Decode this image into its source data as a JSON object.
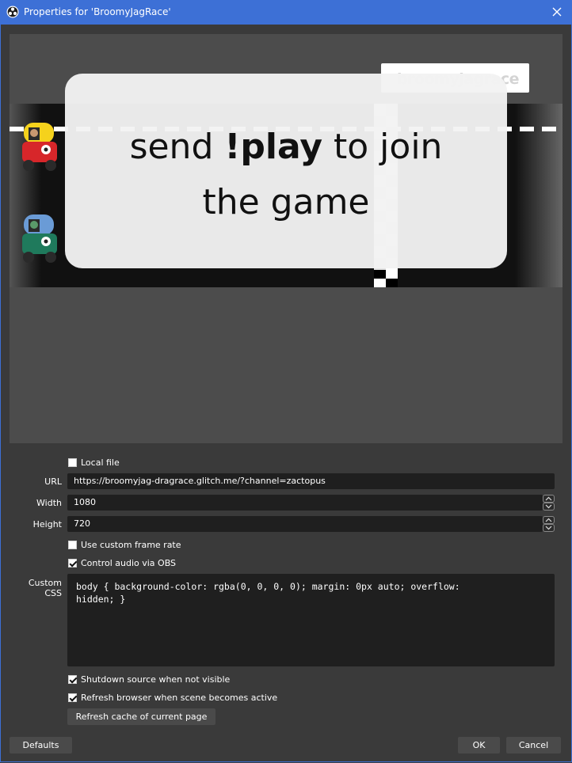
{
  "window": {
    "title": "Properties for 'BroomyJagRace'",
    "icons": {
      "app": "obs-logo-icon",
      "close": "close-icon"
    }
  },
  "preview": {
    "brand_text": "broomyjagrace",
    "message_line1_pre": "send ",
    "message_line1_bold": "!play",
    "message_line1_post": " to join",
    "message_line2": "the game",
    "colors": {
      "track": "#111111",
      "panel": "#4c4c4c",
      "car_red": "#d7262a",
      "car_yellow": "#f5d21c",
      "car_green": "#1f7a5c",
      "car_blue": "#6a9bd6"
    }
  },
  "form": {
    "local_file": {
      "label": "Local file",
      "checked": false
    },
    "url": {
      "label": "URL",
      "value": "https://broomyjag-dragrace.glitch.me/?channel=zactopus"
    },
    "width": {
      "label": "Width",
      "value": "1080"
    },
    "height": {
      "label": "Height",
      "value": "720"
    },
    "custom_frame_rate": {
      "label": "Use custom frame rate",
      "checked": false
    },
    "control_audio": {
      "label": "Control audio via OBS",
      "checked": true
    },
    "custom_css": {
      "label": "Custom CSS",
      "value": "body { background-color: rgba(0, 0, 0, 0); margin: 0px auto; overflow:\nhidden; }"
    },
    "shutdown_source": {
      "label": "Shutdown source when not visible",
      "checked": true
    },
    "refresh_browser": {
      "label": "Refresh browser when scene becomes active",
      "checked": true
    },
    "refresh_cache_label": "Refresh cache of current page"
  },
  "footer": {
    "defaults_label": "Defaults",
    "ok_label": "OK",
    "cancel_label": "Cancel"
  }
}
